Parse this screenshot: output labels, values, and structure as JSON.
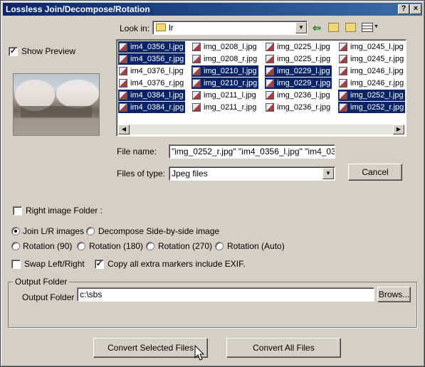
{
  "window": {
    "title": "Lossless Join/Decompose/Rotation",
    "help_label": "?",
    "close_label": "×"
  },
  "preview": {
    "show_preview_label": "Show Preview",
    "show_preview_checked": true
  },
  "lookin": {
    "label": "Look in:",
    "folder": "lr"
  },
  "files": {
    "col1": [
      {
        "name": "im4_0356_l.jpg",
        "selected": true
      },
      {
        "name": "im4_0356_r.jpg",
        "selected": true
      },
      {
        "name": "im4_0376_l.jpg",
        "selected": false
      },
      {
        "name": "im4_0376_r.jpg",
        "selected": false
      },
      {
        "name": "im4_0384_l.jpg",
        "selected": true
      },
      {
        "name": "im4_0384_r.jpg",
        "selected": true
      }
    ],
    "col2": [
      {
        "name": "img_0208_l.jpg",
        "selected": false
      },
      {
        "name": "img_0208_r.jpg",
        "selected": false
      },
      {
        "name": "img_0210_l.jpg",
        "selected": true
      },
      {
        "name": "img_0210_r.jpg",
        "selected": true
      },
      {
        "name": "img_0211_l.jpg",
        "selected": false
      },
      {
        "name": "img_0211_r.jpg",
        "selected": false
      }
    ],
    "col3": [
      {
        "name": "img_0225_l.jpg",
        "selected": false
      },
      {
        "name": "img_0225_r.jpg",
        "selected": false
      },
      {
        "name": "img_0229_l.jpg",
        "selected": true
      },
      {
        "name": "img_0229_r.jpg",
        "selected": true
      },
      {
        "name": "img_0236_l.jpg",
        "selected": false
      },
      {
        "name": "img_0236_r.jpg",
        "selected": false
      }
    ],
    "col4": [
      {
        "name": "img_0245_l.jpg",
        "selected": false
      },
      {
        "name": "img_0245_r.jpg",
        "selected": false
      },
      {
        "name": "img_0246_l.jpg",
        "selected": false
      },
      {
        "name": "img_0246_r.jpg",
        "selected": false
      },
      {
        "name": "img_0252_l.jpg",
        "selected": true
      },
      {
        "name": "img_0252_r.jpg",
        "selected": true
      }
    ]
  },
  "filename": {
    "label": "File name:",
    "value": "\"img_0252_r.jpg\" \"im4_0356_l.jpg\" \"im4_0356_"
  },
  "filetype": {
    "label": "Files of type:",
    "value": "Jpeg files"
  },
  "cancel_label": "Cancel",
  "right_folder": {
    "label": "Right image Folder :",
    "checked": false
  },
  "options": {
    "join": "Join L/R images",
    "decompose": "Decompose Side-by-side image",
    "rot90": "Rotation (90)",
    "rot180": "Rotation (180)",
    "rot270": "Rotation (270)",
    "rotauto": "Rotation (Auto)",
    "selected": "join"
  },
  "swap": {
    "label": "Swap Left/Right",
    "checked": false
  },
  "copy_markers": {
    "label": "Copy all extra markers include EXIF.",
    "checked": true
  },
  "output": {
    "group_label": "Output Folder",
    "label": "Output Folder :",
    "value": "c:\\sbs",
    "browse_label": "Brows..."
  },
  "convert_selected_label": "Convert Selected Files",
  "convert_all_label": "Convert All Files"
}
